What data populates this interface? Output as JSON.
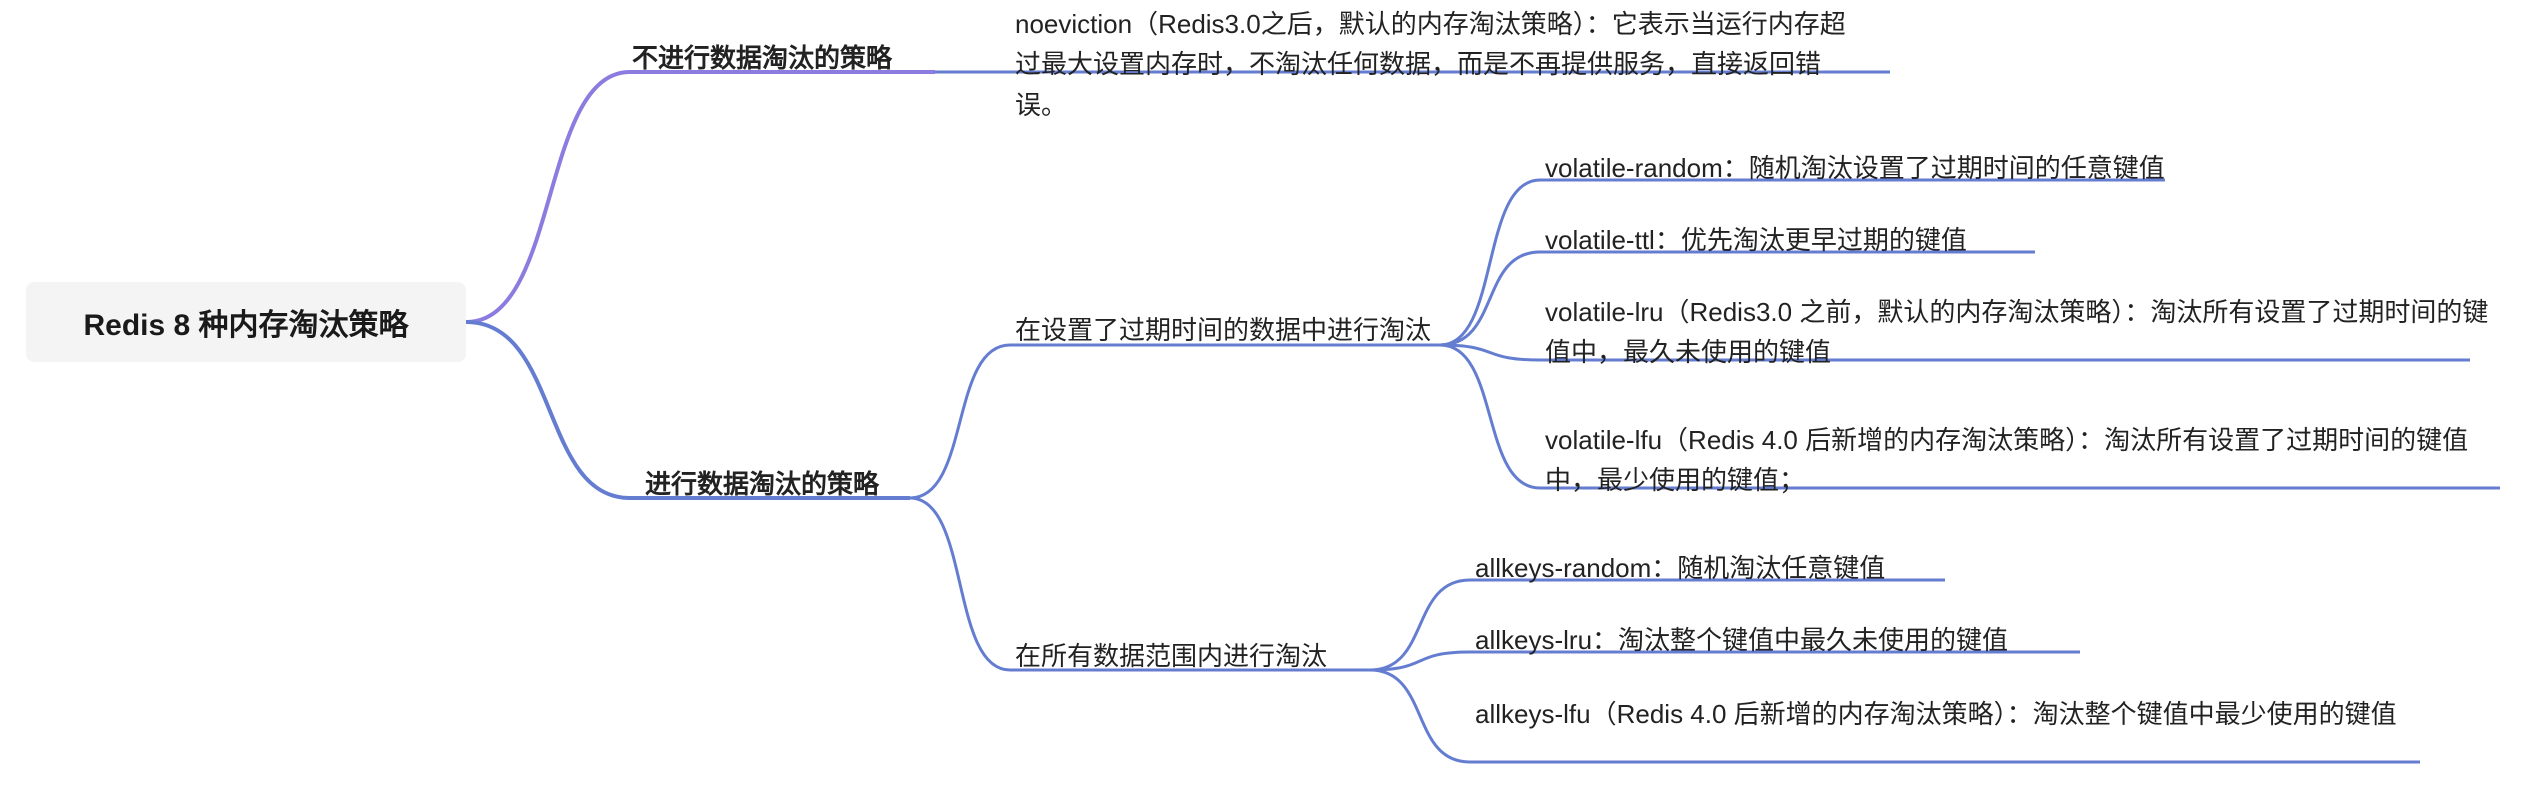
{
  "root": "Redis 8 种内存淘汰策略",
  "branches": {
    "no_evict": {
      "label": "不进行数据淘汰的策略",
      "leaves": [
        "noeviction（Redis3.0之后，默认的内存淘汰策略）：它表示当运行内存超过最大设置内存时，不淘汰任何数据，而是不再提供服务，直接返回错误。"
      ]
    },
    "evict": {
      "label": "进行数据淘汰的策略",
      "volatile": {
        "label": "在设置了过期时间的数据中进行淘汰",
        "leaves": [
          "volatile-random：随机淘汰设置了过期时间的任意键值",
          "volatile-ttl：优先淘汰更早过期的键值",
          "volatile-lru（Redis3.0 之前，默认的内存淘汰策略）：淘汰所有设置了过期时间的键值中，最久未使用的键值",
          "volatile-lfu（Redis 4.0 后新增的内存淘汰策略）：淘汰所有设置了过期时间的键值中，最少使用的键值；"
        ]
      },
      "allkeys": {
        "label": "在所有数据范围内进行淘汰",
        "leaves": [
          "allkeys-random：随机淘汰任意键值",
          "allkeys-lru：淘汰整个键值中最久未使用的键值",
          "allkeys-lfu（Redis 4.0 后新增的内存淘汰策略）：淘汰整个键值中最少使用的键值"
        ]
      }
    }
  },
  "colors": {
    "root_bg": "#f4f4f5",
    "branch_top": "#8d7ce0",
    "branch_bottom": "#647dd1",
    "sub": "#647dd1",
    "leaf_line": "#647dd1"
  }
}
